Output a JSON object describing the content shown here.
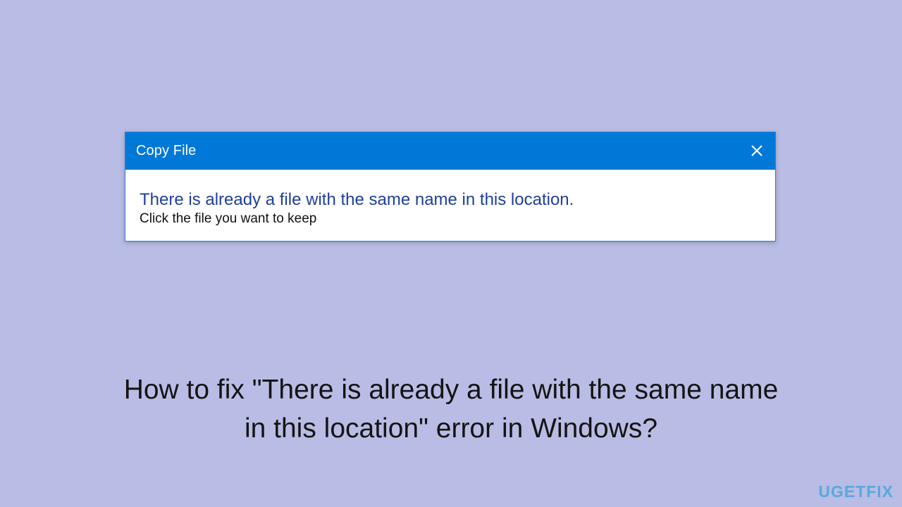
{
  "dialog": {
    "title": "Copy File",
    "message": "There is already a file with the same name in this location.",
    "instruction": "Click the file you want to keep",
    "close_icon": "close-icon"
  },
  "caption": {
    "line1": "How to fix \"There is already a file with the same name",
    "line2": "in this location\" error in Windows?"
  },
  "logo": {
    "text": "UGETFIX"
  },
  "colors": {
    "background": "#b9bce4",
    "titlebar": "#0078d7",
    "message_text": "#1f3f99",
    "logo": "#58a8dd"
  }
}
